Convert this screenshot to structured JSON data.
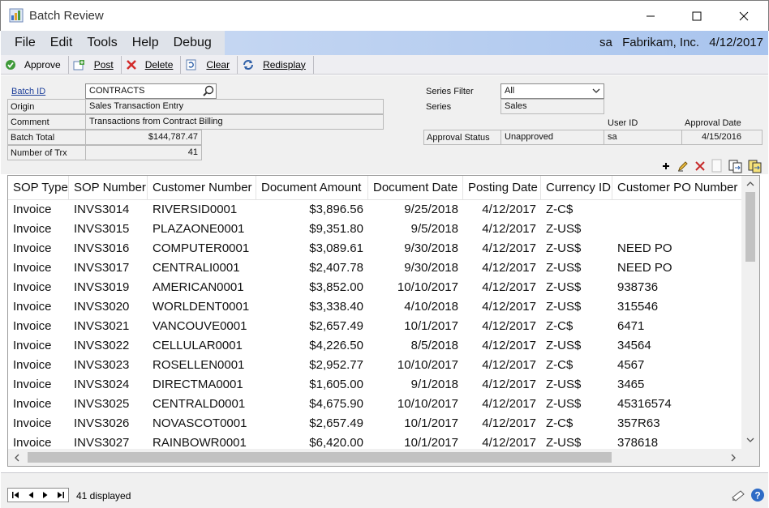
{
  "window": {
    "title": "Batch Review"
  },
  "menu": {
    "items": [
      "File",
      "Edit",
      "Tools",
      "Help",
      "Debug"
    ],
    "user": "sa",
    "company": "Fabrikam, Inc.",
    "date": "4/12/2017"
  },
  "toolbar": {
    "approve": "Approve",
    "post": "Post",
    "delete": "Delete",
    "clear": "Clear",
    "redisplay": "Redisplay"
  },
  "form": {
    "batch_id_label": "Batch ID",
    "batch_id": "CONTRACTS",
    "origin_label": "Origin",
    "origin": "Sales Transaction Entry",
    "comment_label": "Comment",
    "comment": "Transactions from Contract Billing",
    "batch_total_label": "Batch Total",
    "batch_total": "$144,787.47",
    "num_trx_label": "Number of Trx",
    "num_trx": "41",
    "series_filter_label": "Series Filter",
    "series_filter": "All",
    "series_label": "Series",
    "series": "Sales",
    "user_id_label": "User ID",
    "approval_date_label": "Approval Date",
    "approval_status_label": "Approval Status",
    "approval_status": "Unapproved",
    "user_id": "sa",
    "approval_date": "4/15/2016"
  },
  "grid": {
    "columns": [
      "SOP Type",
      "SOP Number",
      "Customer Number",
      "Document Amount",
      "Document Date",
      "Posting Date",
      "Currency ID",
      "Customer PO Number"
    ],
    "rows": [
      [
        "Invoice",
        "INVS3014",
        "RIVERSID0001",
        "$3,896.56",
        "9/25/2018",
        "4/12/2017",
        "Z-C$",
        ""
      ],
      [
        "Invoice",
        "INVS3015",
        "PLAZAONE0001",
        "$9,351.80",
        "9/5/2018",
        "4/12/2017",
        "Z-US$",
        ""
      ],
      [
        "Invoice",
        "INVS3016",
        "COMPUTER0001",
        "$3,089.61",
        "9/30/2018",
        "4/12/2017",
        "Z-US$",
        "NEED PO"
      ],
      [
        "Invoice",
        "INVS3017",
        "CENTRALI0001",
        "$2,407.78",
        "9/30/2018",
        "4/12/2017",
        "Z-US$",
        "NEED PO"
      ],
      [
        "Invoice",
        "INVS3019",
        "AMERICAN0001",
        "$3,852.00",
        "10/10/2017",
        "4/12/2017",
        "Z-US$",
        "938736"
      ],
      [
        "Invoice",
        "INVS3020",
        "WORLDENT0001",
        "$3,338.40",
        "4/10/2018",
        "4/12/2017",
        "Z-US$",
        "315546"
      ],
      [
        "Invoice",
        "INVS3021",
        "VANCOUVE0001",
        "$2,657.49",
        "10/1/2017",
        "4/12/2017",
        "Z-C$",
        "6471"
      ],
      [
        "Invoice",
        "INVS3022",
        "CELLULAR0001",
        "$4,226.50",
        "8/5/2018",
        "4/12/2017",
        "Z-US$",
        "34564"
      ],
      [
        "Invoice",
        "INVS3023",
        "ROSELLEN0001",
        "$2,952.77",
        "10/10/2017",
        "4/12/2017",
        "Z-C$",
        "4567"
      ],
      [
        "Invoice",
        "INVS3024",
        "DIRECTMA0001",
        "$1,605.00",
        "9/1/2018",
        "4/12/2017",
        "Z-US$",
        "3465"
      ],
      [
        "Invoice",
        "INVS3025",
        "CENTRALD0001",
        "$4,675.90",
        "10/10/2017",
        "4/12/2017",
        "Z-US$",
        "45316574"
      ],
      [
        "Invoice",
        "INVS3026",
        "NOVASCOT0001",
        "$2,657.49",
        "10/1/2017",
        "4/12/2017",
        "Z-C$",
        "357R63"
      ],
      [
        "Invoice",
        "INVS3027",
        "RAINBOWR0001",
        "$6,420.00",
        "10/1/2017",
        "4/12/2017",
        "Z-US$",
        "378618"
      ]
    ]
  },
  "status": {
    "displayed": "41 displayed"
  }
}
